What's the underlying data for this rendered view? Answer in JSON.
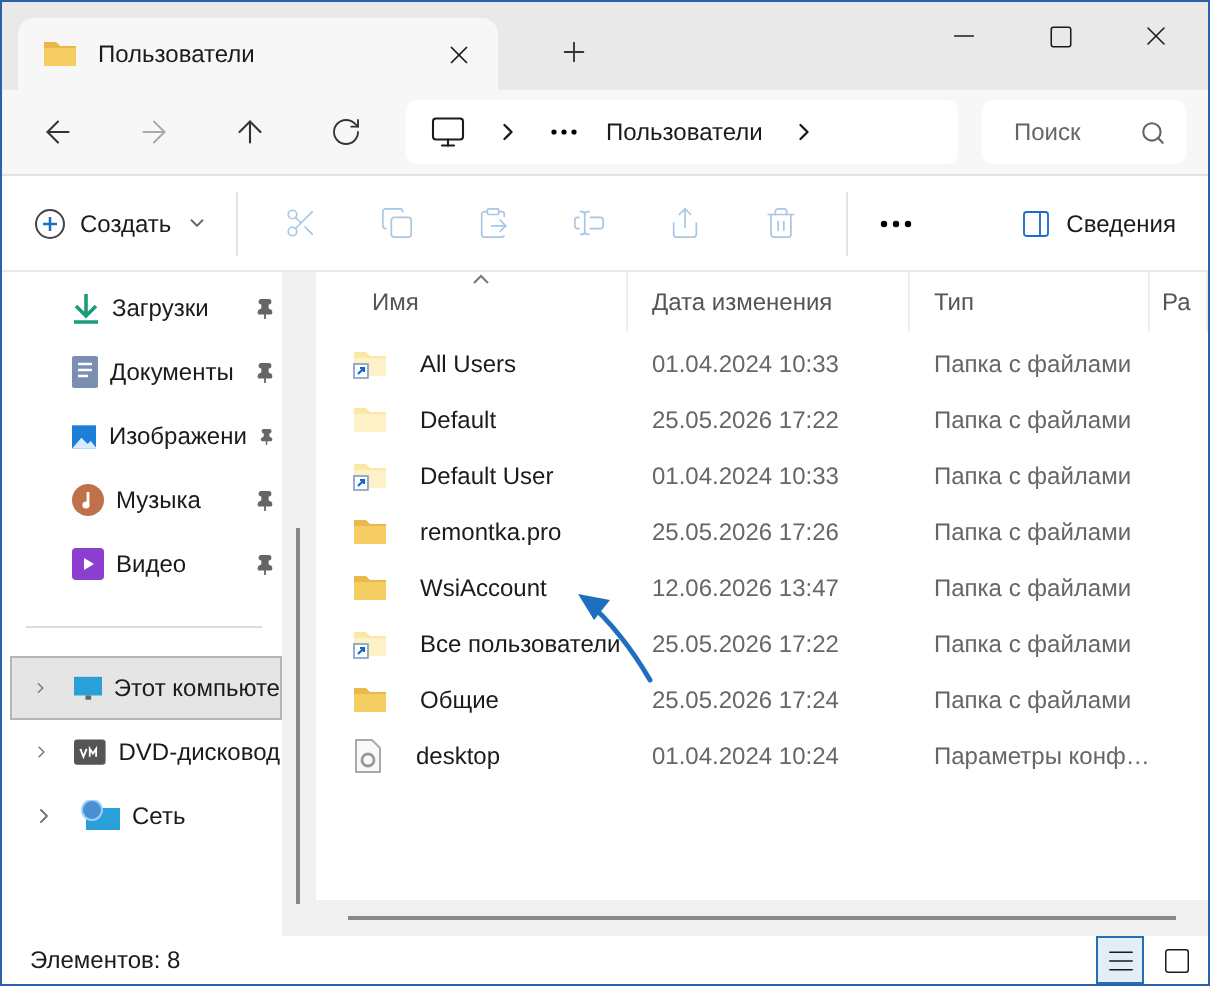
{
  "tabs": [
    {
      "title": "Пользователи",
      "selected": true
    }
  ],
  "address": {
    "path": "Пользователи"
  },
  "search": {
    "placeholder": "Поиск"
  },
  "toolbar": {
    "create": "Создать",
    "actions": [
      {
        "kind": "cut",
        "disabled": true
      },
      {
        "kind": "copy",
        "disabled": true
      },
      {
        "kind": "paste",
        "disabled": true
      },
      {
        "kind": "rename",
        "disabled": true
      },
      {
        "kind": "share",
        "disabled": true
      },
      {
        "kind": "delete",
        "disabled": true
      }
    ],
    "details": "Сведения"
  },
  "sidebar": {
    "quick": [
      {
        "label": "Загрузки",
        "kind": "downloads",
        "pinned": true
      },
      {
        "label": "Документы",
        "kind": "documents",
        "pinned": true
      },
      {
        "label": "Изображени",
        "kind": "pictures",
        "pinned": true
      },
      {
        "label": "Музыка",
        "kind": "music",
        "pinned": true
      },
      {
        "label": "Видео",
        "kind": "video",
        "pinned": true
      }
    ],
    "tree": [
      {
        "label": "Этот компьюте",
        "kind": "computer",
        "selected": true,
        "expanded": false
      },
      {
        "label": "DVD-дисковод",
        "kind": "dvd",
        "selected": false,
        "expanded": false
      },
      {
        "label": "Сеть",
        "kind": "network",
        "selected": false,
        "expanded": false
      }
    ]
  },
  "columns": [
    {
      "label": "Имя",
      "sorted": true
    },
    {
      "label": "Дата изменения",
      "sorted": false
    },
    {
      "label": "Тип",
      "sorted": false
    },
    {
      "label": "Ра",
      "sorted": false
    }
  ],
  "files": [
    {
      "name": "All Users",
      "date": "01.04.2024 10:33",
      "type": "Папка с файлами",
      "kind": "shortcut"
    },
    {
      "name": "Default",
      "date": "25.05.2026 17:22",
      "type": "Папка с файлами",
      "kind": "hidden"
    },
    {
      "name": "Default User",
      "date": "01.04.2024 10:33",
      "type": "Папка с файлами",
      "kind": "shortcut"
    },
    {
      "name": "remontka.pro",
      "date": "25.05.2026 17:26",
      "type": "Папка с файлами",
      "kind": "folder"
    },
    {
      "name": "WsiAccount",
      "date": "12.06.2026 13:47",
      "type": "Папка с файлами",
      "kind": "folder"
    },
    {
      "name": "Все пользователи",
      "date": "25.05.2026 17:22",
      "type": "Папка с файлами",
      "kind": "shortcut"
    },
    {
      "name": "Общие",
      "date": "25.05.2026 17:24",
      "type": "Папка с файлами",
      "kind": "folder"
    },
    {
      "name": "desktop",
      "date": "01.04.2024 10:24",
      "type": "Параметры конф…",
      "kind": "settings-file"
    }
  ],
  "status": {
    "count": "Элементов: 8"
  },
  "views": [
    {
      "kind": "details",
      "selected": true
    },
    {
      "kind": "tiles",
      "selected": false
    }
  ]
}
